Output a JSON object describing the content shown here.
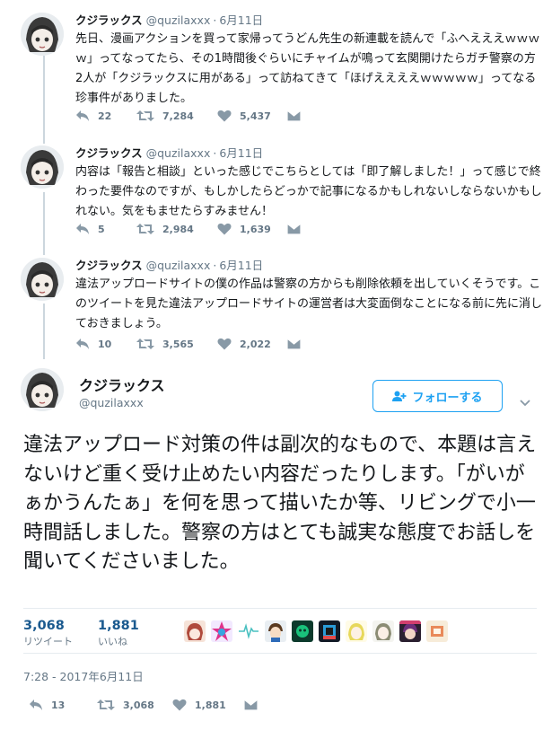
{
  "colors": {
    "accent": "#1da1f2",
    "count_blue": "#1b5a8f",
    "meta_gray": "#657786",
    "icon_gray": "#8899a6",
    "text": "#14171a",
    "divider": "#e6ecf0"
  },
  "thread": [
    {
      "name": "クジラックス",
      "handle": "@quzilaxxx",
      "date": "6月11日",
      "text": "先日、漫画アクションを買って家帰ってうどん先生の新連載を読んで「ふへえええｗｗｗｗ」ってなってたら、その1時間後ぐらいにチャイムが鳴って玄関開けたらガチ警察の方2人が「クジラックスに用がある」って訪ねてきて「ほげええええｗｗｗｗｗ」ってなる珍事件がありました。",
      "replies": "22",
      "retweets": "7,284",
      "likes": "5,437"
    },
    {
      "name": "クジラックス",
      "handle": "@quzilaxxx",
      "date": "6月11日",
      "text": "内容は「報告と相談」といった感じでこちらとしては「即了解しました！」って感じで終わった要件なのですが、もしかしたらどっかで記事になるかもしれないしならないかもしれない。気をもませたらすみません！",
      "replies": "5",
      "retweets": "2,984",
      "likes": "1,639"
    },
    {
      "name": "クジラックス",
      "handle": "@quzilaxxx",
      "date": "6月11日",
      "text": "違法アップロードサイトの僕の作品は警察の方からも削除依頼を出していくそうです。このツイートを見た違法アップロードサイトの運営者は大変面倒なことになる前に先に消しておきましょう。",
      "replies": "10",
      "retweets": "3,565",
      "likes": "2,022"
    }
  ],
  "main": {
    "name": "クジラックス",
    "handle": "@quzilaxxx",
    "follow_label": "フォローする",
    "text": "違法アップロード対策の件は副次的なもので、本題は言えないけど重く受け止めたい内容だったりします。「がいがぁかうんたぁ」を何を思って描いたか等、リビングで小一時間話しました。警察の方はとても誠実な態度でお話しを聞いてくださいました。",
    "retweets_count": "3,068",
    "retweets_label": "リツイート",
    "likes_count": "1,881",
    "likes_label": "いいね",
    "timestamp": "7:28 - 2017年6月11日",
    "replies": "13",
    "retweets": "3,068",
    "likes": "1,881"
  },
  "icons": {
    "reply": "reply-icon",
    "retweet": "retweet-icon",
    "like": "heart-icon",
    "dm": "envelope-icon",
    "caret": "chevron-down-icon",
    "follow": "follow-person-icon"
  }
}
